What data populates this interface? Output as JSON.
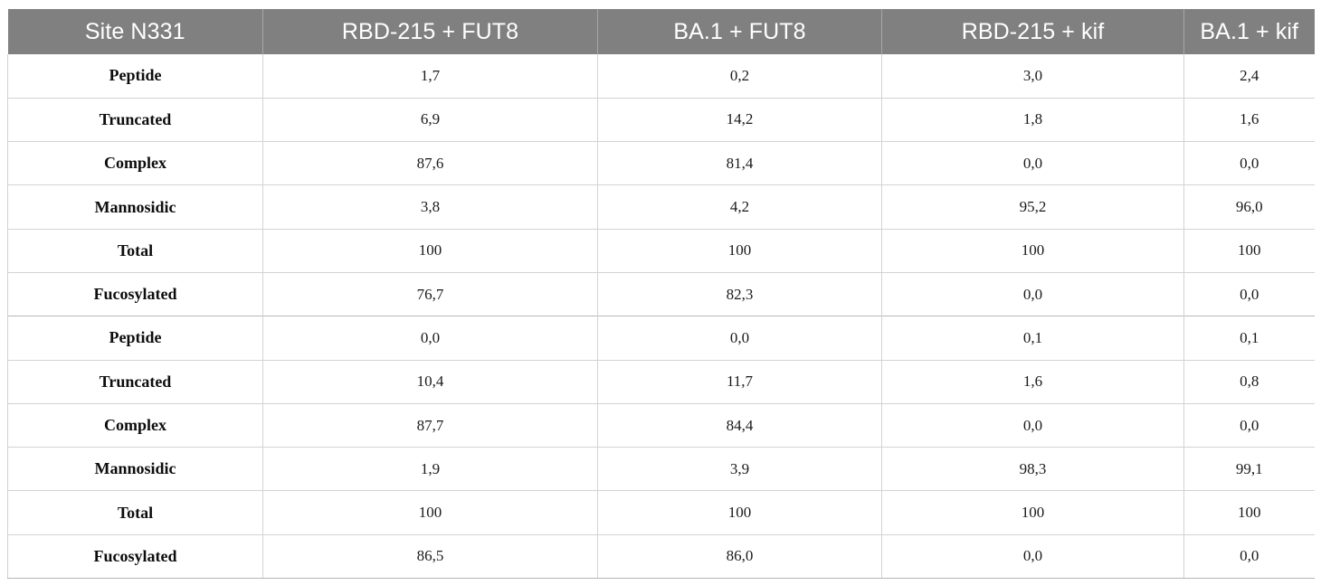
{
  "table": {
    "caption_key": "Site N331",
    "columns": [
      {
        "id": "site",
        "label": "Site N331"
      },
      {
        "id": "rbd215_fut8",
        "label": "RBD-215 + FUT8"
      },
      {
        "id": "ba1_fut8",
        "label": "BA.1 + FUT8"
      },
      {
        "id": "rbd215_kif",
        "label": "RBD-215 + kif"
      },
      {
        "id": "ba1_kif",
        "label": "BA.1 + kif"
      }
    ],
    "rows": [
      {
        "label": "Peptide",
        "values": [
          "1,7",
          "0,2",
          "3,0",
          "2,4"
        ],
        "section": 1
      },
      {
        "label": "Truncated",
        "values": [
          "6,9",
          "14,2",
          "1,8",
          "1,6"
        ],
        "section": 1
      },
      {
        "label": "Complex",
        "values": [
          "87,6",
          "81,4",
          "0,0",
          "0,0"
        ],
        "section": 1
      },
      {
        "label": "Mannosidic",
        "values": [
          "3,8",
          "4,2",
          "95,2",
          "96,0"
        ],
        "section": 1
      },
      {
        "label": "Total",
        "values": [
          "100",
          "100",
          "100",
          "100"
        ],
        "section": 1
      },
      {
        "label": "Fucosylated",
        "values": [
          "76,7",
          "82,3",
          "0,0",
          "0,0"
        ],
        "section": 1
      },
      {
        "label": "Peptide",
        "values": [
          "0,0",
          "0,0",
          "0,1",
          "0,1"
        ],
        "section": 2
      },
      {
        "label": "Truncated",
        "values": [
          "10,4",
          "11,7",
          "1,6",
          "0,8"
        ],
        "section": 2
      },
      {
        "label": "Complex",
        "values": [
          "87,7",
          "84,4",
          "0,0",
          "0,0"
        ],
        "section": 2
      },
      {
        "label": "Mannosidic",
        "values": [
          "1,9",
          "3,9",
          "98,3",
          "99,1"
        ],
        "section": 2
      },
      {
        "label": "Total",
        "values": [
          "100",
          "100",
          "100",
          "100"
        ],
        "section": 2
      },
      {
        "label": "Fucosylated",
        "values": [
          "86,5",
          "86,0",
          "0,0",
          "0,0"
        ],
        "section": 2
      }
    ],
    "colors": {
      "header_background": "#808080",
      "header_text": "#ffffff",
      "body_background": "#ffffff",
      "body_text": "#1a1a1a",
      "grid_line": "#d3d3d3",
      "outer_border": "#b5b5b5"
    }
  }
}
